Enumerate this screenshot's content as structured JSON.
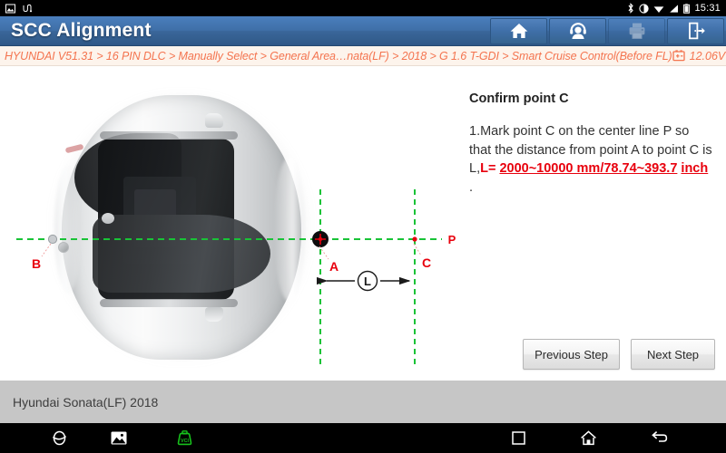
{
  "status_bar": {
    "left_icons": [
      "screenshot-icon",
      "usb-debug-icon"
    ],
    "right_icons": [
      "bluetooth-icon",
      "do-not-disturb-icon",
      "wifi-icon",
      "signal-icon",
      "battery-icon"
    ],
    "clock": "15:31"
  },
  "title_bar": {
    "title": "SCC Alignment",
    "actions": [
      {
        "name": "home-button",
        "icon": "home-icon",
        "disabled": false
      },
      {
        "name": "support-button",
        "icon": "headset-icon",
        "disabled": false
      },
      {
        "name": "print-button",
        "icon": "printer-icon",
        "disabled": true
      },
      {
        "name": "exit-button",
        "icon": "exit-icon",
        "disabled": false
      }
    ]
  },
  "breadcrumb": {
    "path": "HYUNDAI V51.31 > 16 PIN DLC > Manually Select > General Area…nata(LF) > 2018 > G 1.6 T-GDI > Smart Cruise Control(Before FL)",
    "battery_icon": "battery-voltage-icon",
    "voltage": "12.06V"
  },
  "instructions": {
    "heading": "Confirm point C",
    "line_1": "1.Mark point C on the center line P so",
    "line_2": "that the distance from point A to point C",
    "line_3_prefix": "is L,",
    "line_3_red": "L= ",
    "line_3_highlight": "2000~10000 mm/78.74~393.7",
    "line_4_highlight": "inch",
    "line_4_suffix": " ."
  },
  "diagram": {
    "labels": {
      "point_a": "A",
      "point_b": "B",
      "point_c": "C",
      "line_p": "P",
      "distance_l": "L"
    },
    "colors": {
      "guide_green": "#19c337",
      "marker_red": "#e8000d",
      "dimension_black": "#1a1a1a"
    },
    "vehicle": "top-view-sedan"
  },
  "buttons": {
    "previous_step": "Previous Step",
    "next_step": "Next Step"
  },
  "vehicle_bar": {
    "vehicle": "Hyundai Sonata(LF) 2018"
  },
  "nav_bar": {
    "items": [
      {
        "name": "browser-icon",
        "label": "browser"
      },
      {
        "name": "gallery-icon",
        "label": "gallery"
      },
      {
        "name": "vci-icon",
        "label": "VCI"
      },
      {
        "name": "recents-icon",
        "label": "recents"
      },
      {
        "name": "home-icon",
        "label": "home"
      },
      {
        "name": "back-icon",
        "label": "back"
      }
    ],
    "vci_color": "#17c21c"
  }
}
